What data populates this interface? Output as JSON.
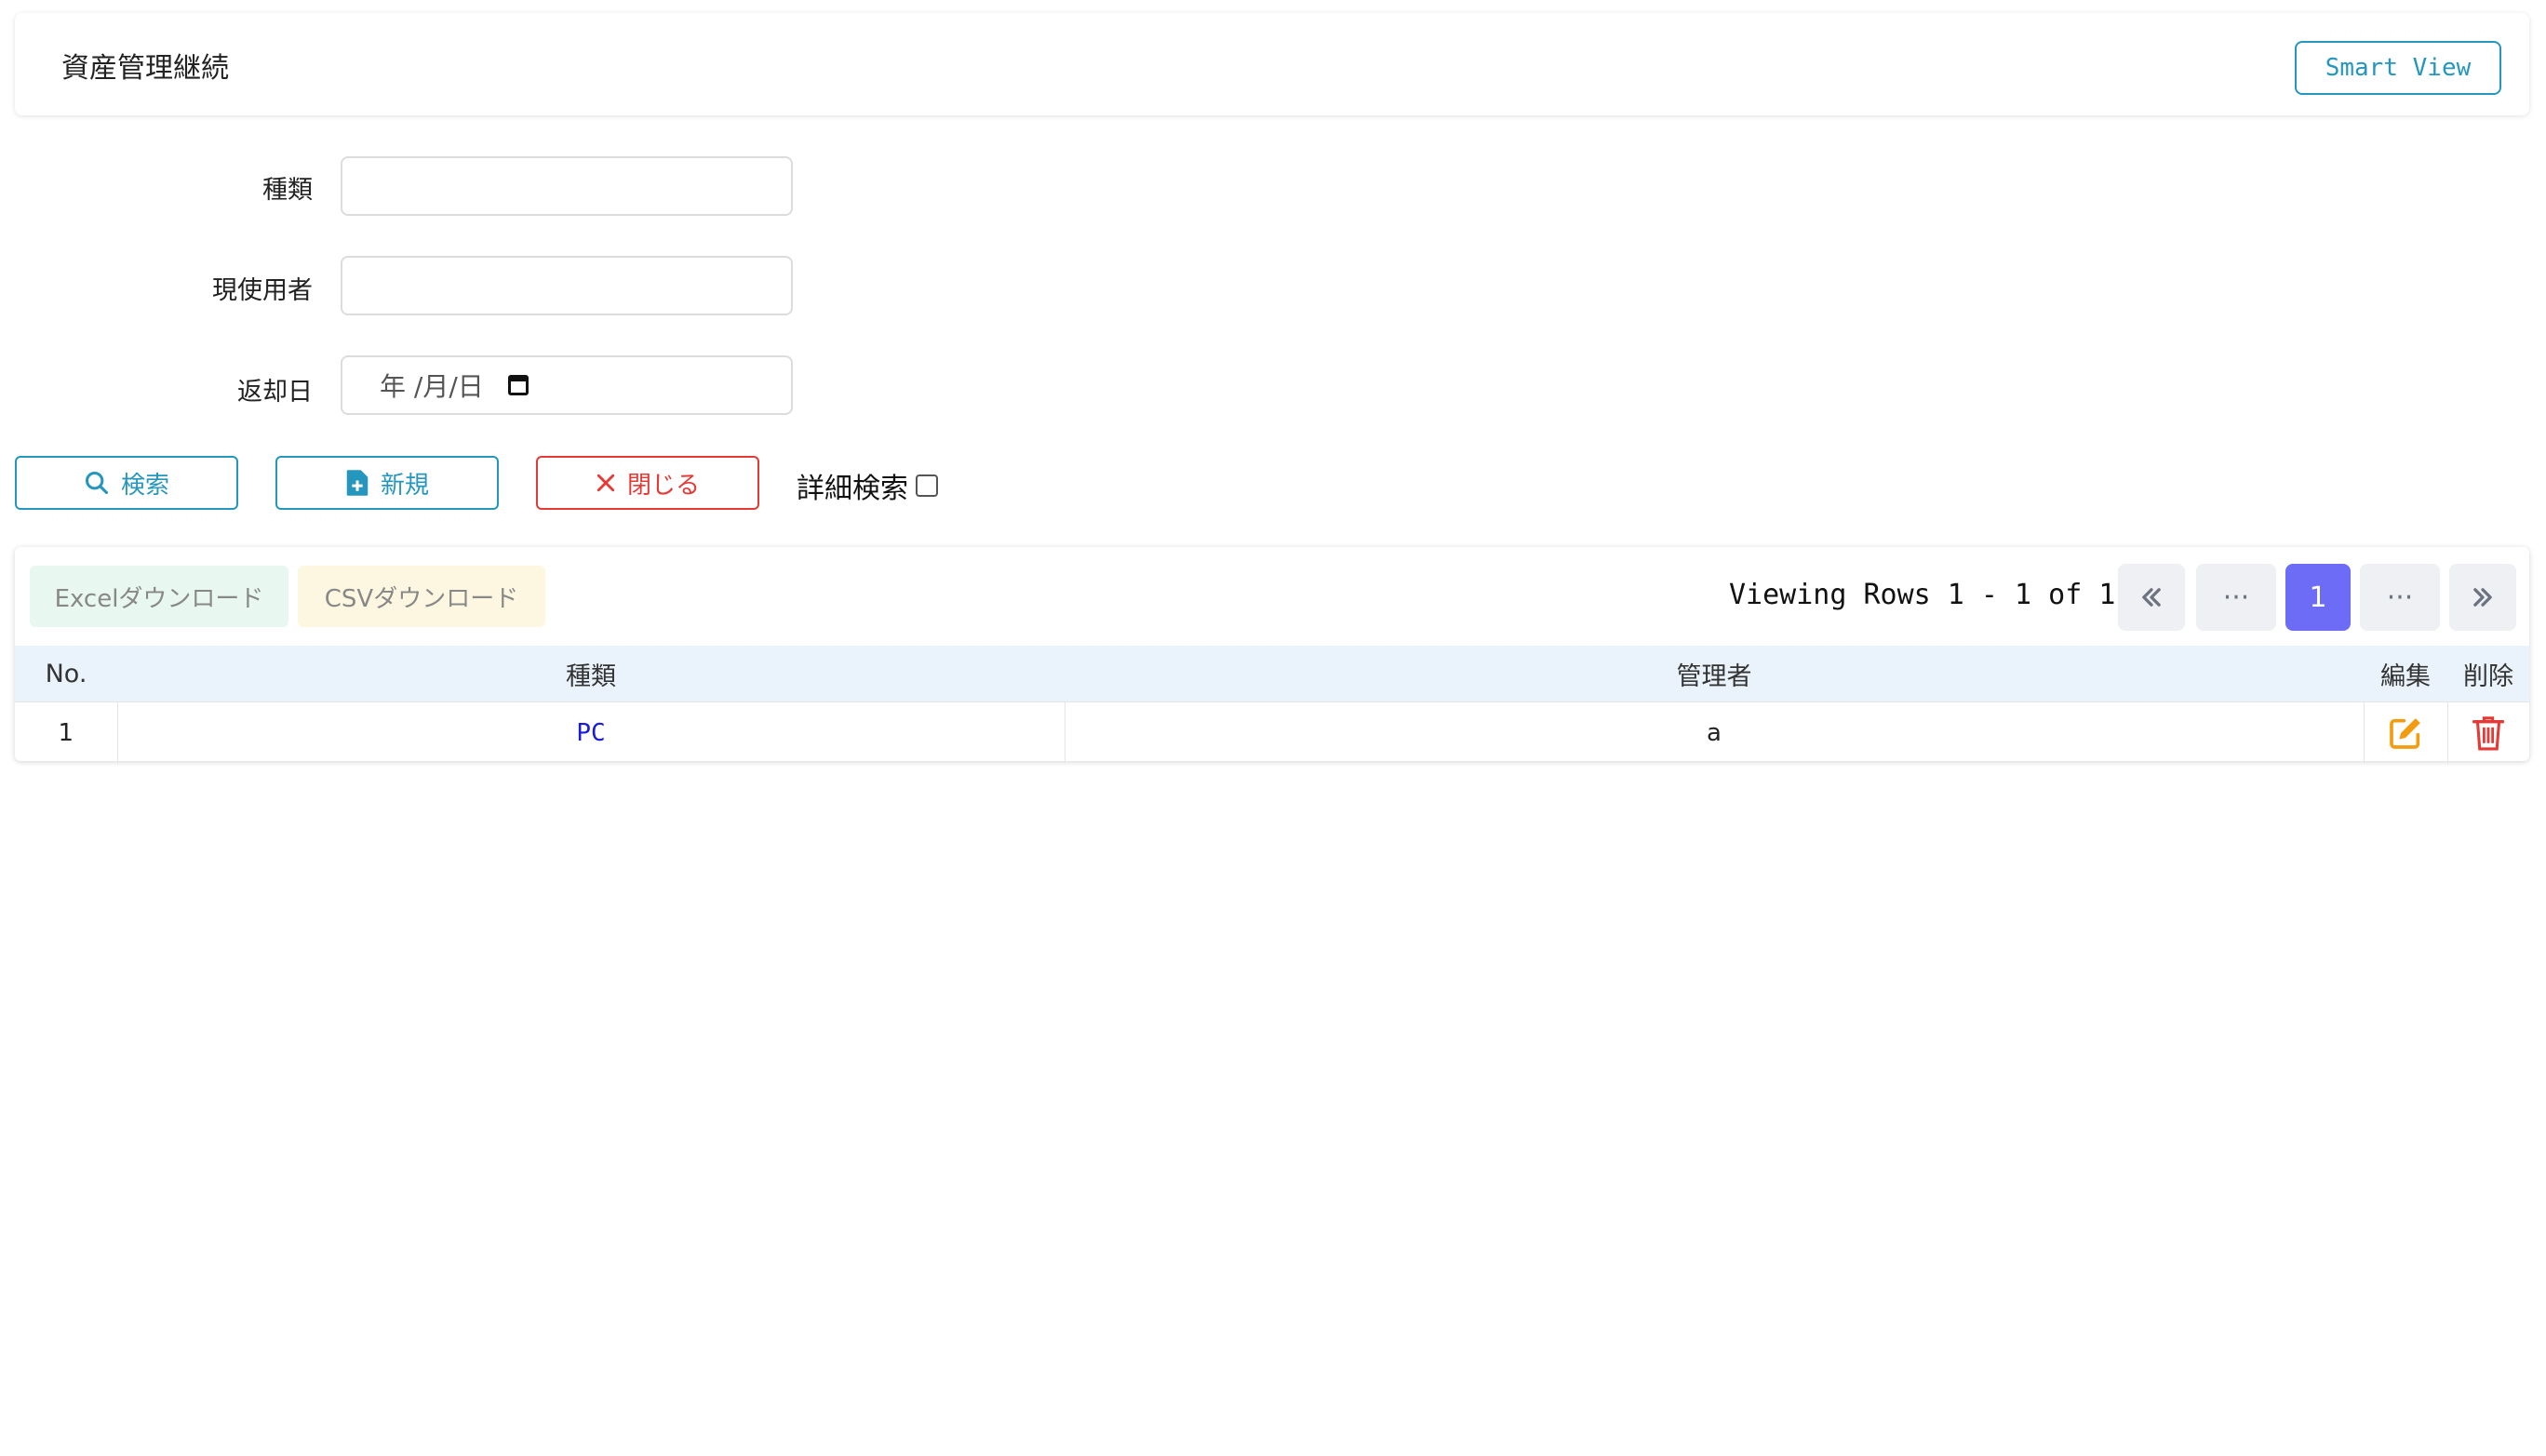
{
  "header": {
    "title": "資産管理継続",
    "smart_view_label": "Smart View"
  },
  "form": {
    "type_label": "種類",
    "current_user_label": "現使用者",
    "return_date_label": "返却日",
    "return_date_placeholder": "年 /月/日"
  },
  "actions": {
    "search_label": "検索",
    "new_label": "新規",
    "close_label": "閉じる",
    "detail_search_label": "詳細検索"
  },
  "export": {
    "excel_label": "Excelダウンロード",
    "csv_label": "CSVダウンロード"
  },
  "pagination": {
    "viewing_text": "Viewing Rows 1 - 1 of 1",
    "first": "«",
    "prev_ellipsis": "···",
    "current_page": "1",
    "next_ellipsis": "···",
    "last": "»"
  },
  "table": {
    "headers": {
      "no": "No.",
      "type": "種類",
      "manager": "管理者",
      "edit": "編集",
      "delete": "削除"
    },
    "rows": [
      {
        "no": "1",
        "type": "PC",
        "manager": "a"
      }
    ]
  },
  "icons": {
    "search": "search-icon",
    "new": "file-plus-icon",
    "close": "close-icon",
    "edit": "edit-icon",
    "delete": "trash-icon"
  },
  "colors": {
    "primary": "#2596be",
    "danger": "#e53935",
    "active_page": "#6c6cf7",
    "edit_icon": "#f39c12",
    "delete_icon": "#e53935",
    "link": "#1a1adc"
  }
}
